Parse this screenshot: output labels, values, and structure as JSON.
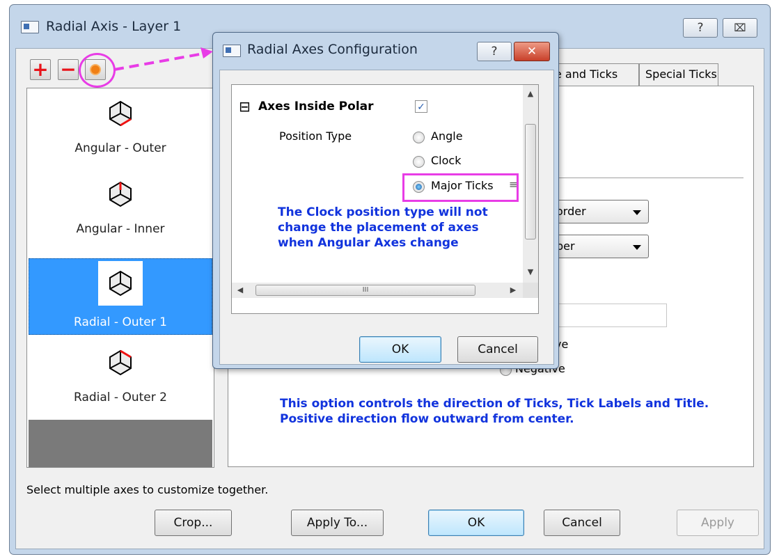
{
  "main_window": {
    "title": "Radial Axis - Layer 1",
    "help_button": "?",
    "close_button": "⌧",
    "toolbar": {
      "add": "+",
      "remove": "−"
    },
    "axis_list": [
      {
        "label": "Angular - Outer"
      },
      {
        "label": "Angular - Inner"
      },
      {
        "label": "Radial - Outer 1"
      },
      {
        "label": "Radial - Outer 2"
      }
    ],
    "tabs": [
      {
        "label": "e and Ticks"
      },
      {
        "label": "Special Ticks"
      }
    ],
    "combo1": "order",
    "combo2": "per",
    "direction_positive": "ve",
    "direction_negative": "Negative",
    "note": "This option controls the direction of Ticks, Tick Labels and Title. Positive direction flow outward from center.",
    "status_text": "Select multiple axes to customize together.",
    "buttons": {
      "crop": "Crop...",
      "apply_to": "Apply To...",
      "ok": "OK",
      "cancel": "Cancel",
      "apply": "Apply"
    }
  },
  "config_dialog": {
    "title": "Radial Axes Configuration",
    "help_button": "?",
    "close_button": "✕",
    "tree_expander": "⊟",
    "section_label": "Axes Inside Polar",
    "section_checked": "✓",
    "position_type_label": "Position Type",
    "options": [
      {
        "label": "Angle",
        "selected": false
      },
      {
        "label": "Clock",
        "selected": false
      },
      {
        "label": "Major Ticks",
        "selected": true
      }
    ],
    "note": "The Clock position type will not change the placement of axes when Angular Axes change",
    "scroll_grip": "≡",
    "hscroll_grip": "III",
    "buttons": {
      "ok": "OK",
      "cancel": "Cancel"
    }
  },
  "colors": {
    "annotation": "#e83ce6",
    "note_blue": "#1133dd",
    "selection": "#3399ff"
  }
}
